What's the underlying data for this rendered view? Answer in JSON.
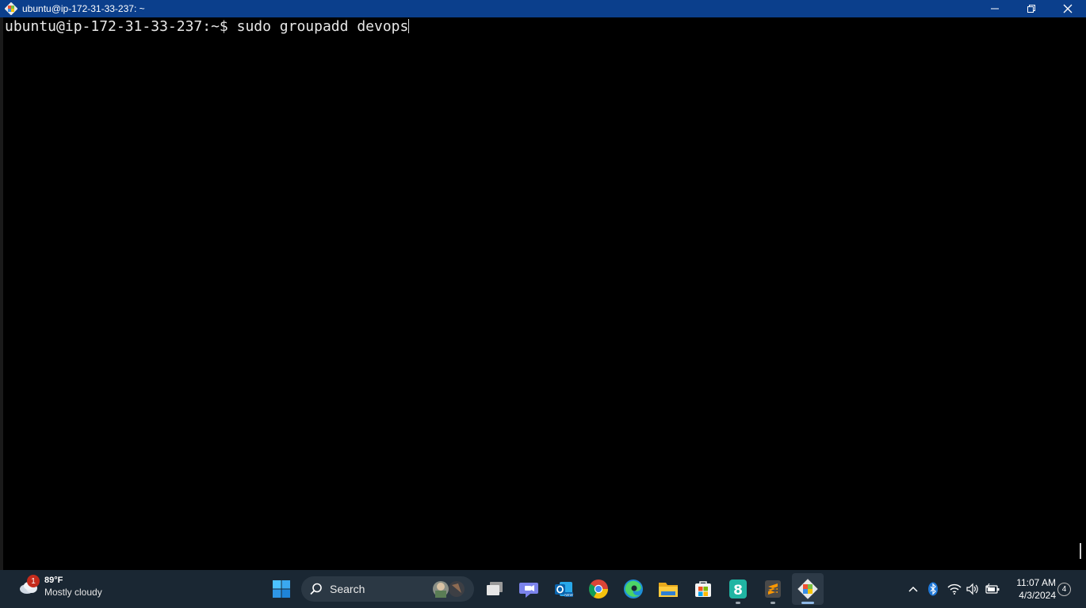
{
  "window": {
    "title": "ubuntu@ip-172-31-33-237: ~",
    "minimize_icon": "minimize-icon",
    "restore_icon": "restore-icon",
    "close_icon": "close-icon"
  },
  "terminal": {
    "prompt": "ubuntu@ip-172-31-33-237:~$",
    "command": " sudo groupadd devops",
    "background": "#000000",
    "foreground": "#e8e8e8"
  },
  "taskbar": {
    "weather": {
      "badge": "1",
      "temperature": "89°F",
      "condition": "Mostly cloudy"
    },
    "search": {
      "label": "Search"
    },
    "apps": [
      "start-icon",
      "task-view-icon",
      "teams-icon",
      "outlook-icon",
      "chrome-icon",
      "edge-icon",
      "file-explorer-icon",
      "microsoft-store-icon",
      "app-8-icon",
      "sublime-text-icon",
      "git-bash-icon"
    ],
    "clock": {
      "time": "11:07 AM",
      "date": "4/3/2024"
    },
    "notifications": "4",
    "background": "#1a2733"
  }
}
